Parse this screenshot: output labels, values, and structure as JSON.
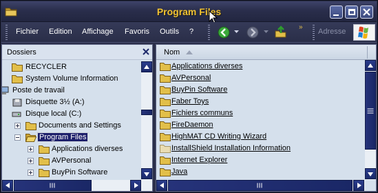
{
  "window": {
    "title": "Program Files",
    "accent": "#f1c232",
    "selection_color": "#1d1f6b"
  },
  "menubar": {
    "items": [
      "Fichier",
      "Edition",
      "Affichage",
      "Favoris",
      "Outils",
      "?"
    ],
    "address_label": "Adresse",
    "toolbar_icons": [
      "back-icon",
      "forward-icon",
      "up-folder-icon"
    ]
  },
  "left_panel": {
    "title": "Dossiers",
    "tree": [
      {
        "label": "RECYCLER",
        "icon": "folder"
      },
      {
        "label": "System Volume Information",
        "icon": "folder"
      },
      {
        "label": "Poste de travail",
        "icon": "computer"
      },
      {
        "label": "Disquette 3½ (A:)",
        "icon": "floppy"
      },
      {
        "label": "Disque local (C:)",
        "icon": "drive"
      },
      {
        "label": "Documents and Settings",
        "icon": "folder"
      },
      {
        "label": "Program Files",
        "icon": "folder-open",
        "selected": true
      },
      {
        "label": "Applications diverses",
        "icon": "folder"
      },
      {
        "label": "AVPersonal",
        "icon": "folder"
      },
      {
        "label": "BuyPin Software",
        "icon": "folder"
      }
    ]
  },
  "right_panel": {
    "column_name": "Nom",
    "files": [
      "Applications diverses",
      "AVPersonal",
      "BuyPin Software",
      "Faber Toys",
      "Fichiers communs",
      "FireDaemon",
      "HighMAT CD Writing Wizard",
      "InstallShield Installation Information",
      "Internet Explorer",
      "Java"
    ]
  }
}
